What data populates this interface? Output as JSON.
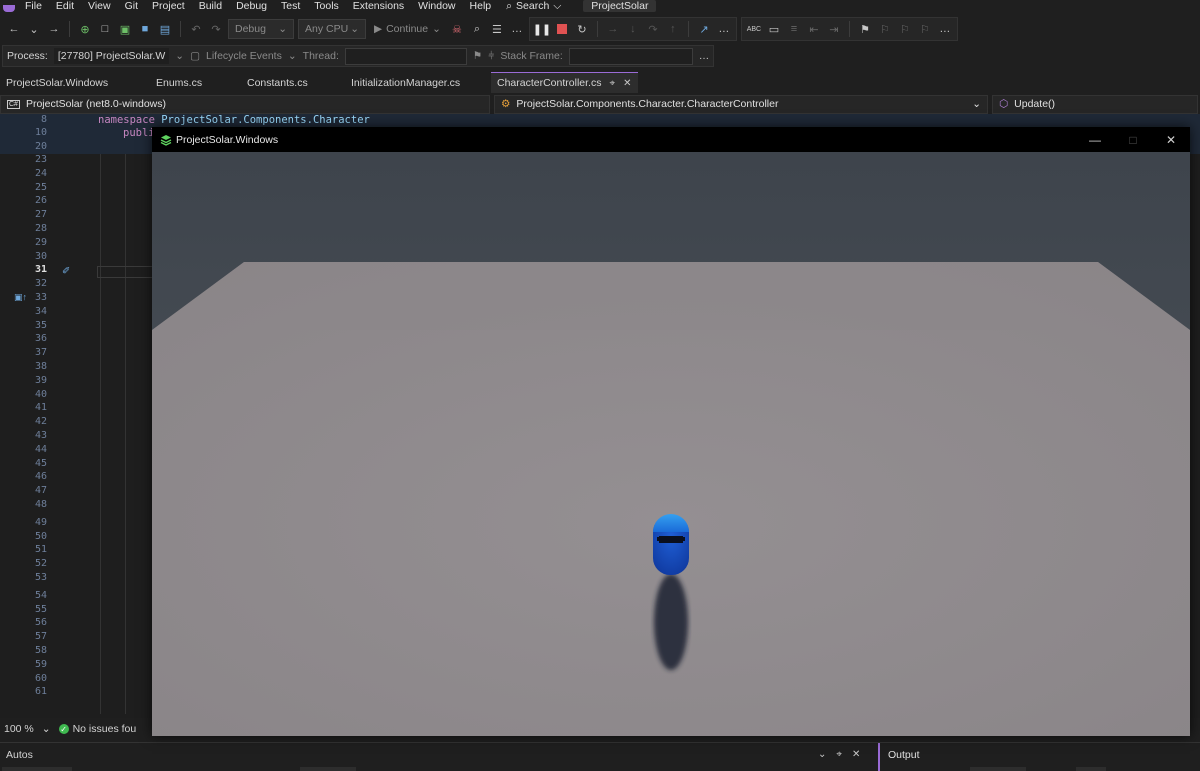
{
  "menu": {
    "items": [
      "File",
      "Edit",
      "View",
      "Git",
      "Project",
      "Build",
      "Debug",
      "Test",
      "Tools",
      "Extensions",
      "Window",
      "Help"
    ],
    "search_label": "Search",
    "project_badge": "ProjectSolar"
  },
  "toolbar": {
    "config": "Debug",
    "platform": "Any CPU",
    "continue_label": "Continue"
  },
  "process_bar": {
    "process_label": "Process:",
    "process_value": "[27780] ProjectSolar.W",
    "lifecycle_label": "Lifecycle Events",
    "thread_label": "Thread:",
    "stack_frame_label": "Stack Frame:"
  },
  "tabs": [
    {
      "label": "ProjectSolar.Windows"
    },
    {
      "label": "Enums.cs"
    },
    {
      "label": "Constants.cs"
    },
    {
      "label": "InitializationManager.cs"
    },
    {
      "label": "CharacterController.cs"
    }
  ],
  "navbar": {
    "project": "ProjectSolar (net8.0-windows)",
    "type": "ProjectSolar.Components.Character.CharacterController",
    "member": "Update()"
  },
  "editor": {
    "line_numbers": [
      "8",
      "10",
      "20",
      "23",
      "24",
      "25",
      "26",
      "27",
      "28",
      "29",
      "30",
      "31",
      "32",
      "33",
      "34",
      "35",
      "36",
      "37",
      "38",
      "39",
      "40",
      "41",
      "42",
      "43",
      "44",
      "45",
      "46",
      "47",
      "48",
      "49",
      "50",
      "51",
      "52",
      "53",
      "54",
      "55",
      "56",
      "57",
      "58",
      "59",
      "60",
      "61"
    ],
    "current_line": "31",
    "code": {
      "namespace_kw": "namespace",
      "namespace_name": "ProjectSolar.Components.Character",
      "public_fragment": "publi"
    }
  },
  "status": {
    "zoom": "100 %",
    "issues": "No issues fou"
  },
  "bottom": {
    "autos_title": "Autos",
    "output_title": "Output"
  },
  "game_window": {
    "title": "ProjectSolar.Windows",
    "colors": {
      "sky": "#4a5058",
      "floor": "#8f8a8d",
      "character": "#1a4ec0",
      "character_top": "#2a8ce8"
    }
  },
  "colors": {
    "accent": "#9a6bd6",
    "editor_bg": "#1e1e1e",
    "chrome_bg": "#1f1f1f"
  }
}
